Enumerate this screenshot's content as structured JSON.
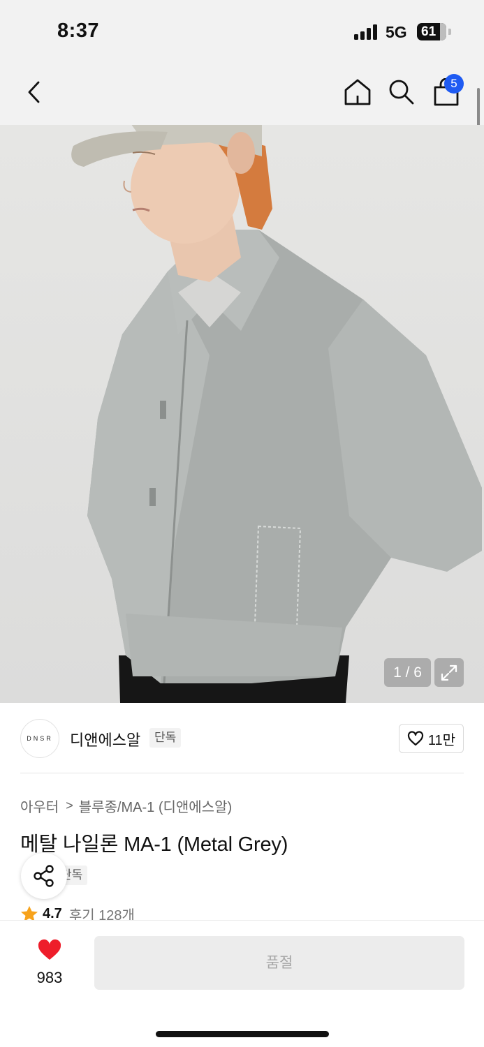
{
  "status_bar": {
    "time": "8:37",
    "network": "5G",
    "battery": "61"
  },
  "nav": {
    "back_icon": "chevron-left-icon",
    "home_icon": "home-icon",
    "search_icon": "search-icon",
    "cart_icon": "bag-icon",
    "cart_count": "5"
  },
  "gallery": {
    "counter": "1 / 6",
    "expand_icon": "expand-icon"
  },
  "brand": {
    "logo_text": "DNSR",
    "name": "디앤에스알",
    "tag": "단독",
    "likes": "11만"
  },
  "breadcrumb": {
    "category": "아우터",
    "subcategory": "블루종/MA-1 (디앤에스알)"
  },
  "product": {
    "title": "메탈 나일론 MA-1 (Metal Grey)",
    "tag": "단독",
    "rating": "4.7",
    "reviews": "후기 128개"
  },
  "bottom": {
    "wish_count": "983",
    "soldout_label": "품절"
  },
  "colors": {
    "accent": "#1f5bf2",
    "heart": "#ee1d2a",
    "star": "#f7a21b",
    "disabled_bg": "#ececec"
  }
}
